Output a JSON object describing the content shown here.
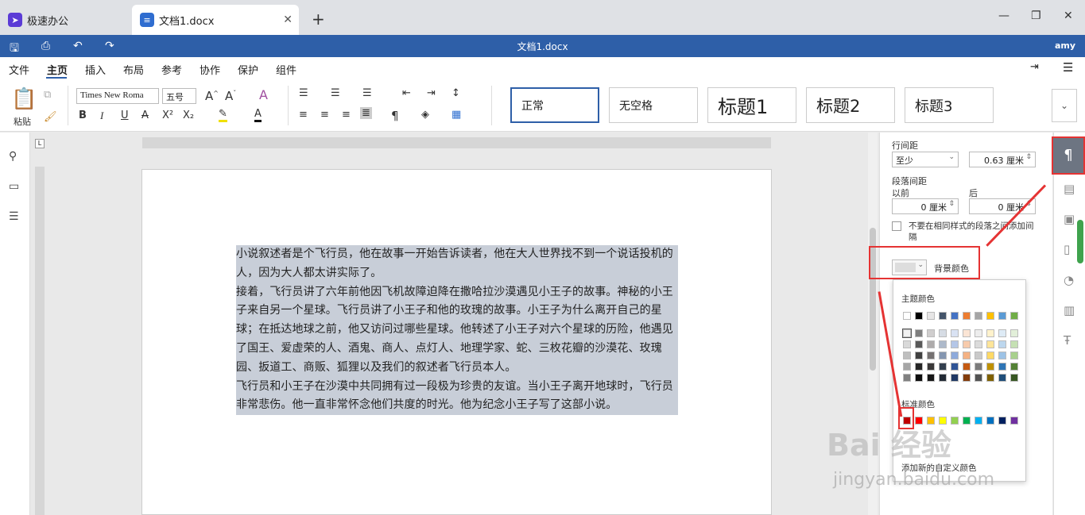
{
  "tabs": [
    {
      "label": "极速办公",
      "icon": "rocket-icon"
    },
    {
      "label": "文档1.docx",
      "icon": "document-icon",
      "active": true
    }
  ],
  "title": "文档1.docx",
  "user": "amy",
  "menu": [
    "文件",
    "主页",
    "插入",
    "布局",
    "参考",
    "协作",
    "保护",
    "组件"
  ],
  "ribbon": {
    "paste_label": "粘贴",
    "font_name": "Times New Roma",
    "font_size": "五号",
    "styles": [
      "正常",
      "无空格",
      "标题1",
      "标题2",
      "标题3"
    ]
  },
  "document": {
    "paragraphs": [
      "小说叙述者是个飞行员，他在故事一开始告诉读者，他在大人世界找不到一个说话投机的人，因为大人都太讲实际了。",
      "接着，飞行员讲了六年前他因飞机故障迫降在撒哈拉沙漠遇见小王子的故事。神秘的小王子来自另一个星球。飞行员讲了小王子和他的玫瑰的故事。小王子为什么离开自己的星球；在抵达地球之前，他又访问过哪些星球。他转述了小王子对六个星球的历险，他遇见了国王、爱虚荣的人、酒鬼、商人、点灯人、地理学家、蛇、三枚花瓣的沙漠花、玫瑰园、扳道工、商贩、狐狸以及我们的叙述者飞行员本人。",
      "飞行员和小王子在沙漠中共同拥有过一段极为珍贵的友谊。当小王子离开地球时，飞行员非常悲伤。他一直非常怀念他们共度的时光。他为纪念小王子写了这部小说。"
    ]
  },
  "panel": {
    "line_spacing_label": "行间距",
    "line_spacing_mode": "至少",
    "line_spacing_value": "0.63 厘米",
    "para_spacing_label": "段落间距",
    "before_label": "以前",
    "after_label": "后",
    "before_value": "0 厘米",
    "after_value": "0 厘米",
    "checkbox_label": "不要在相同样式的段落之间添加间隔",
    "bg_color_label": "背景颜色"
  },
  "color_popup": {
    "theme_label": "主题颜色",
    "standard_label": "标准颜色",
    "custom_label": "添加新的自定义颜色",
    "theme_top": [
      "#ffffff",
      "#000000",
      "#e7e6e6",
      "#44546a",
      "#4472c4",
      "#ed7d31",
      "#a5a5a5",
      "#ffc000",
      "#5b9bd5",
      "#70ad47"
    ],
    "theme_cols": [
      [
        "#f2f2f2",
        "#d9d9d9",
        "#bfbfbf",
        "#a6a6a6",
        "#808080"
      ],
      [
        "#7f7f7f",
        "#595959",
        "#404040",
        "#262626",
        "#0d0d0d"
      ],
      [
        "#d0cece",
        "#aeabab",
        "#757171",
        "#3a3838",
        "#161616"
      ],
      [
        "#d6dce4",
        "#adb9ca",
        "#8496b0",
        "#333f4f",
        "#222a35"
      ],
      [
        "#d9e2f3",
        "#b4c6e7",
        "#8eaadb",
        "#2f5496",
        "#1f3864"
      ],
      [
        "#fbe5d5",
        "#f7cbac",
        "#f4b183",
        "#c55a11",
        "#833c0b"
      ],
      [
        "#ededed",
        "#dbdbdb",
        "#c9c9c9",
        "#7b7b7b",
        "#525252"
      ],
      [
        "#fff2cc",
        "#fee599",
        "#ffd965",
        "#bf9000",
        "#7f6000"
      ],
      [
        "#deebf6",
        "#bdd7ee",
        "#9dc3e6",
        "#2e75b5",
        "#1f4e79"
      ],
      [
        "#e2efd9",
        "#c5e0b3",
        "#a8d08d",
        "#538135",
        "#375623"
      ]
    ],
    "standard": [
      "#c00000",
      "#ff0000",
      "#ffc000",
      "#ffff00",
      "#92d050",
      "#00b050",
      "#00b0f0",
      "#0070c0",
      "#002060",
      "#7030a0"
    ]
  },
  "watermark": {
    "brand": "Bai 经验",
    "url": "jingyan.baidu.com"
  }
}
